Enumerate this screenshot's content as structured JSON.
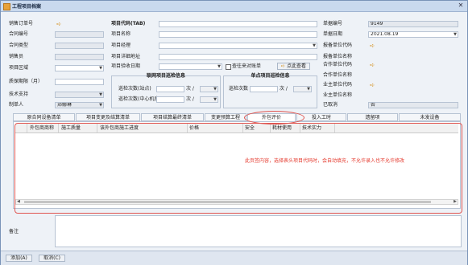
{
  "window": {
    "title": "工程项目档案",
    "close": "✕",
    "app_icon": "folder-icon"
  },
  "form": {
    "left": [
      {
        "label": "销售订单号",
        "value": "",
        "kind": "arrow"
      },
      {
        "label": "合同编号",
        "value": ""
      },
      {
        "label": "合同类型",
        "value": ""
      },
      {
        "label": "销售员",
        "value": ""
      },
      {
        "label": "项目区域",
        "value": "",
        "kind": "select"
      },
      {
        "label": "质保期限（月）",
        "value": ""
      },
      {
        "label": "技术支持",
        "value": "",
        "kind": "select"
      },
      {
        "label": "制单人",
        "value": "郑娜琳",
        "kind": "select"
      }
    ],
    "middle": [
      {
        "label": "项目代码(TAB)",
        "value": ""
      },
      {
        "label": "项目名称",
        "value": ""
      },
      {
        "label": "项目经理",
        "value": "",
        "kind": "select"
      },
      {
        "label": "项目详细地址",
        "value": ""
      },
      {
        "label": "项目验收日期",
        "value": "",
        "kind": "select"
      }
    ],
    "checkbox_label": "查往来对账单",
    "check_button": "点此查看",
    "right": [
      {
        "label": "单据编号",
        "value": "9149"
      },
      {
        "label": "单据日期",
        "value": "2021.08.19",
        "kind": "select"
      },
      {
        "label": "报备单位代码",
        "value": "",
        "kind": "arrow"
      },
      {
        "label": "报备单位名称",
        "value": ""
      },
      {
        "label": "合作单位代码",
        "value": "",
        "kind": "arrow"
      },
      {
        "label": "合作单位名称",
        "value": ""
      },
      {
        "label": "业主单位代码",
        "value": "",
        "kind": "arrow"
      },
      {
        "label": "业主单位名称",
        "value": ""
      },
      {
        "label": "已取消",
        "value": "否"
      }
    ],
    "group_joint": {
      "title": "联网项目巡检信息",
      "row1_label": "巡检次数(站点)",
      "row1_unit": "次 /",
      "row2_label": "巡检次数(中心机房)",
      "row2_unit": "次 /"
    },
    "group_single": {
      "title": "单点项目巡检信息",
      "row_label": "巡检次数",
      "row_unit": "次 /"
    }
  },
  "tabs": [
    {
      "label": "原合同设备清单"
    },
    {
      "label": "项目变更及结算清单"
    },
    {
      "label": "项目结算最终清单"
    },
    {
      "label": "变更预算工程"
    },
    {
      "label": "外包评价",
      "active": true
    },
    {
      "label": "投入工时"
    },
    {
      "label": "遗留项"
    },
    {
      "label": "未发设备"
    }
  ],
  "grid": {
    "columns": [
      "外包商商称",
      "施工质量",
      "该外包商施工进度",
      "价格",
      "安全",
      "耗材使用",
      "技术实力"
    ],
    "rows": []
  },
  "annotation": "此页签内容，选择表头项目代码时，会自动填充，不允许录入也不允许修改",
  "remark": {
    "label": "备注",
    "value": ""
  },
  "footer": {
    "add_label": "添加(A)",
    "cancel_label": "取消(C)"
  },
  "colors": {
    "accent_red": "#e53b2f",
    "arrow_orange": "#d38a0f",
    "titlebar": "#c9d9ee"
  }
}
